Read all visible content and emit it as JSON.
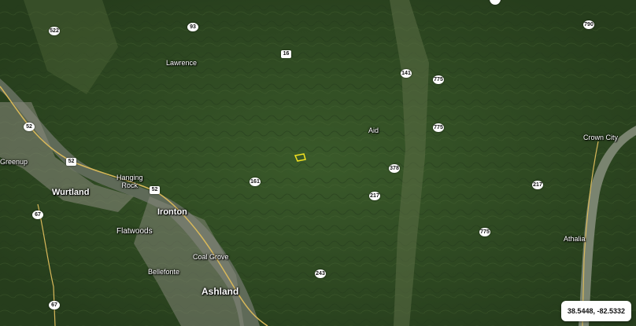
{
  "places": [
    {
      "id": "lawrence",
      "label": "Lawrence"
    },
    {
      "id": "aid",
      "label": "Aid"
    },
    {
      "id": "crown-city",
      "label": "Crown City"
    },
    {
      "id": "greenup",
      "label": "Greenup"
    },
    {
      "id": "hanging-rock",
      "label": "Hanging\nRock"
    },
    {
      "id": "wurtland",
      "label": "Wurtland"
    },
    {
      "id": "ironton",
      "label": "Ironton"
    },
    {
      "id": "flatwoods",
      "label": "Flatwoods"
    },
    {
      "id": "coal-grove",
      "label": "Coal Grove"
    },
    {
      "id": "bellefonte",
      "label": "Bellefonte"
    },
    {
      "id": "athalia",
      "label": "Athalia"
    },
    {
      "id": "ashland",
      "label": "Ashland"
    }
  ],
  "road_shields": [
    {
      "id": "r522",
      "label": "522"
    },
    {
      "id": "r93",
      "label": "93"
    },
    {
      "id": "r16",
      "label": "16"
    },
    {
      "id": "r790",
      "label": "790"
    },
    {
      "id": "r141",
      "label": "141"
    },
    {
      "id": "r775a",
      "label": "775"
    },
    {
      "id": "r775b",
      "label": "775"
    },
    {
      "id": "r52a",
      "label": "52"
    },
    {
      "id": "r52b",
      "label": "52"
    },
    {
      "id": "r52c",
      "label": "52"
    },
    {
      "id": "r161",
      "label": "161"
    },
    {
      "id": "r378",
      "label": "378"
    },
    {
      "id": "r217a",
      "label": "217"
    },
    {
      "id": "r217b",
      "label": "217"
    },
    {
      "id": "r67a",
      "label": "67"
    },
    {
      "id": "r775c",
      "label": "775"
    },
    {
      "id": "r243",
      "label": "243"
    },
    {
      "id": "r67b",
      "label": "67"
    }
  ],
  "coordinates": {
    "latitude": "38.5448",
    "longitude": "-82.5332",
    "display": "38.5448, -82.5332"
  },
  "colors": {
    "forest": "#2f4a22",
    "river": "#5f6a58",
    "urban": "#8a8a7e",
    "road": "#d8b85a",
    "parcel_outline": "#f0e020"
  }
}
